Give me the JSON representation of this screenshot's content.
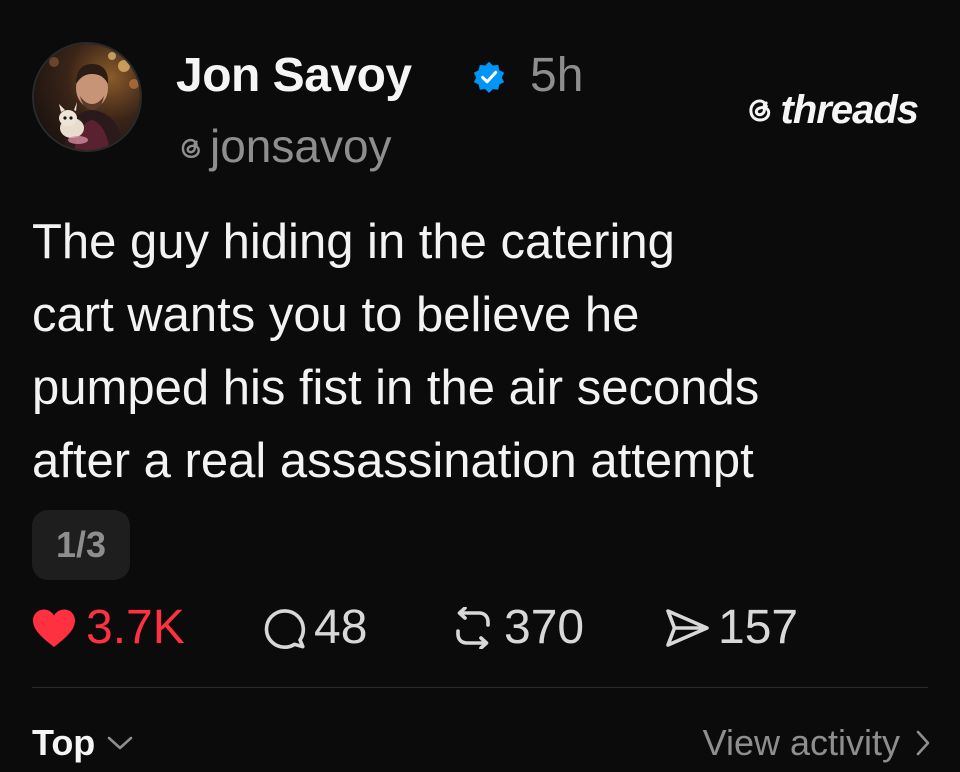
{
  "post": {
    "author": "Jon Savoy",
    "timestamp": "5h",
    "handle": "jonsavoy",
    "verified": true,
    "text_lines": [
      "The guy hiding in the catering",
      "cart wants you to believe he",
      "pumped his fist in the air seconds",
      "after a real assassination attempt"
    ],
    "page_indicator": "1/3"
  },
  "brand": {
    "label": "threads"
  },
  "actions": {
    "likes": "3.7K",
    "comments": "48",
    "reposts": "370",
    "shares": "157"
  },
  "footer": {
    "sort_label": "Top",
    "view_activity_label": "View activity"
  },
  "colors": {
    "background": "#0b0b0b",
    "like_red": "#ff3040",
    "verified_blue": "#0095f6",
    "muted_gray": "#8e8e8e"
  },
  "icons": {
    "verified": "verified-badge-icon",
    "threads_logo": "threads-logo-icon",
    "like": "heart-icon",
    "comment": "comment-bubble-icon",
    "repost": "repost-icon",
    "share": "send-icon",
    "sort": "chevron-down-icon",
    "view_activity": "chevron-right-icon"
  }
}
